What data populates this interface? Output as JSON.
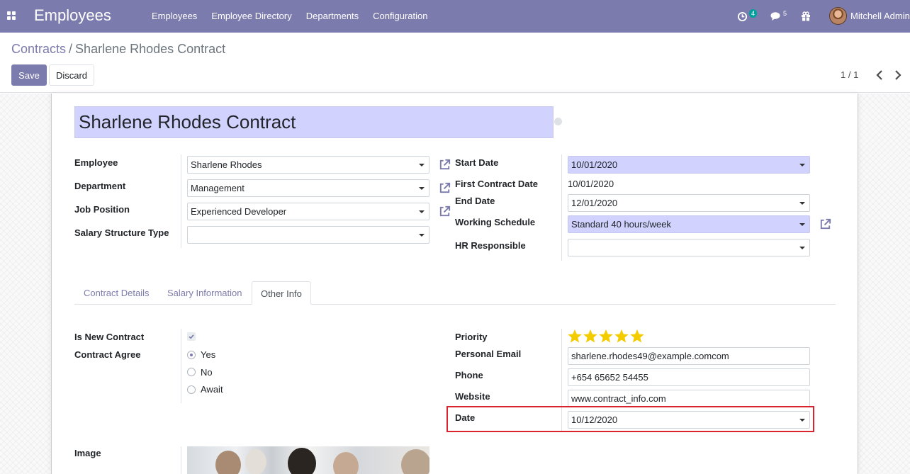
{
  "navbar": {
    "app_title": "Employees",
    "menu": [
      "Employees",
      "Employee Directory",
      "Departments",
      "Configuration"
    ],
    "activity_count": "4",
    "message_count": "5",
    "user_name": "Mitchell Admin"
  },
  "breadcrumb": {
    "parent": "Contracts",
    "separator": "/",
    "current": "Sharlene Rhodes Contract"
  },
  "buttons": {
    "save": "Save",
    "discard": "Discard"
  },
  "pager": {
    "value": "1 / 1"
  },
  "form": {
    "title": "Sharlene Rhodes Contract",
    "left": {
      "employee_label": "Employee",
      "employee_value": "Sharlene Rhodes",
      "department_label": "Department",
      "department_value": "Management",
      "job_position_label": "Job Position",
      "job_position_value": "Experienced Developer",
      "salary_structure_type_label": "Salary Structure Type",
      "salary_structure_type_value": ""
    },
    "right": {
      "start_date_label": "Start Date",
      "start_date_value": "10/01/2020",
      "first_contract_date_label": "First Contract Date",
      "first_contract_date_value": "10/01/2020",
      "end_date_label": "End Date",
      "end_date_value": "12/01/2020",
      "working_schedule_label": "Working Schedule",
      "working_schedule_value": "Standard 40 hours/week",
      "hr_responsible_label": "HR Responsible",
      "hr_responsible_value": ""
    },
    "tabs": [
      "Contract Details",
      "Salary Information",
      "Other Info"
    ],
    "active_tab": "Other Info",
    "other_info": {
      "is_new_contract_label": "Is New Contract",
      "is_new_contract_checked": true,
      "contract_agree_label": "Contract Agree",
      "contract_agree_options": [
        "Yes",
        "No",
        "Await"
      ],
      "contract_agree_selected": "Yes",
      "priority_label": "Priority",
      "priority_stars": 5,
      "priority_max": 5,
      "personal_email_label": "Personal Email",
      "personal_email_value": "sharlene.rhodes49@example.comcom",
      "phone_label": "Phone",
      "phone_value": "+654 65652 54455",
      "website_label": "Website",
      "website_value": "www.contract_info.com",
      "date_label": "Date",
      "date_value": "10/12/2020",
      "image_label": "Image"
    }
  },
  "colors": {
    "brand": "#7c7bad",
    "required_field": "#d2d2ff",
    "star": "#f3cc00",
    "highlight_border": "#d9232d"
  },
  "icons": [
    "apps-icon",
    "activity-clock-icon",
    "chat-icon",
    "gift-icon",
    "external-link-icon",
    "chevron-left-icon",
    "chevron-right-icon",
    "star-icon",
    "checkmark-icon"
  ]
}
